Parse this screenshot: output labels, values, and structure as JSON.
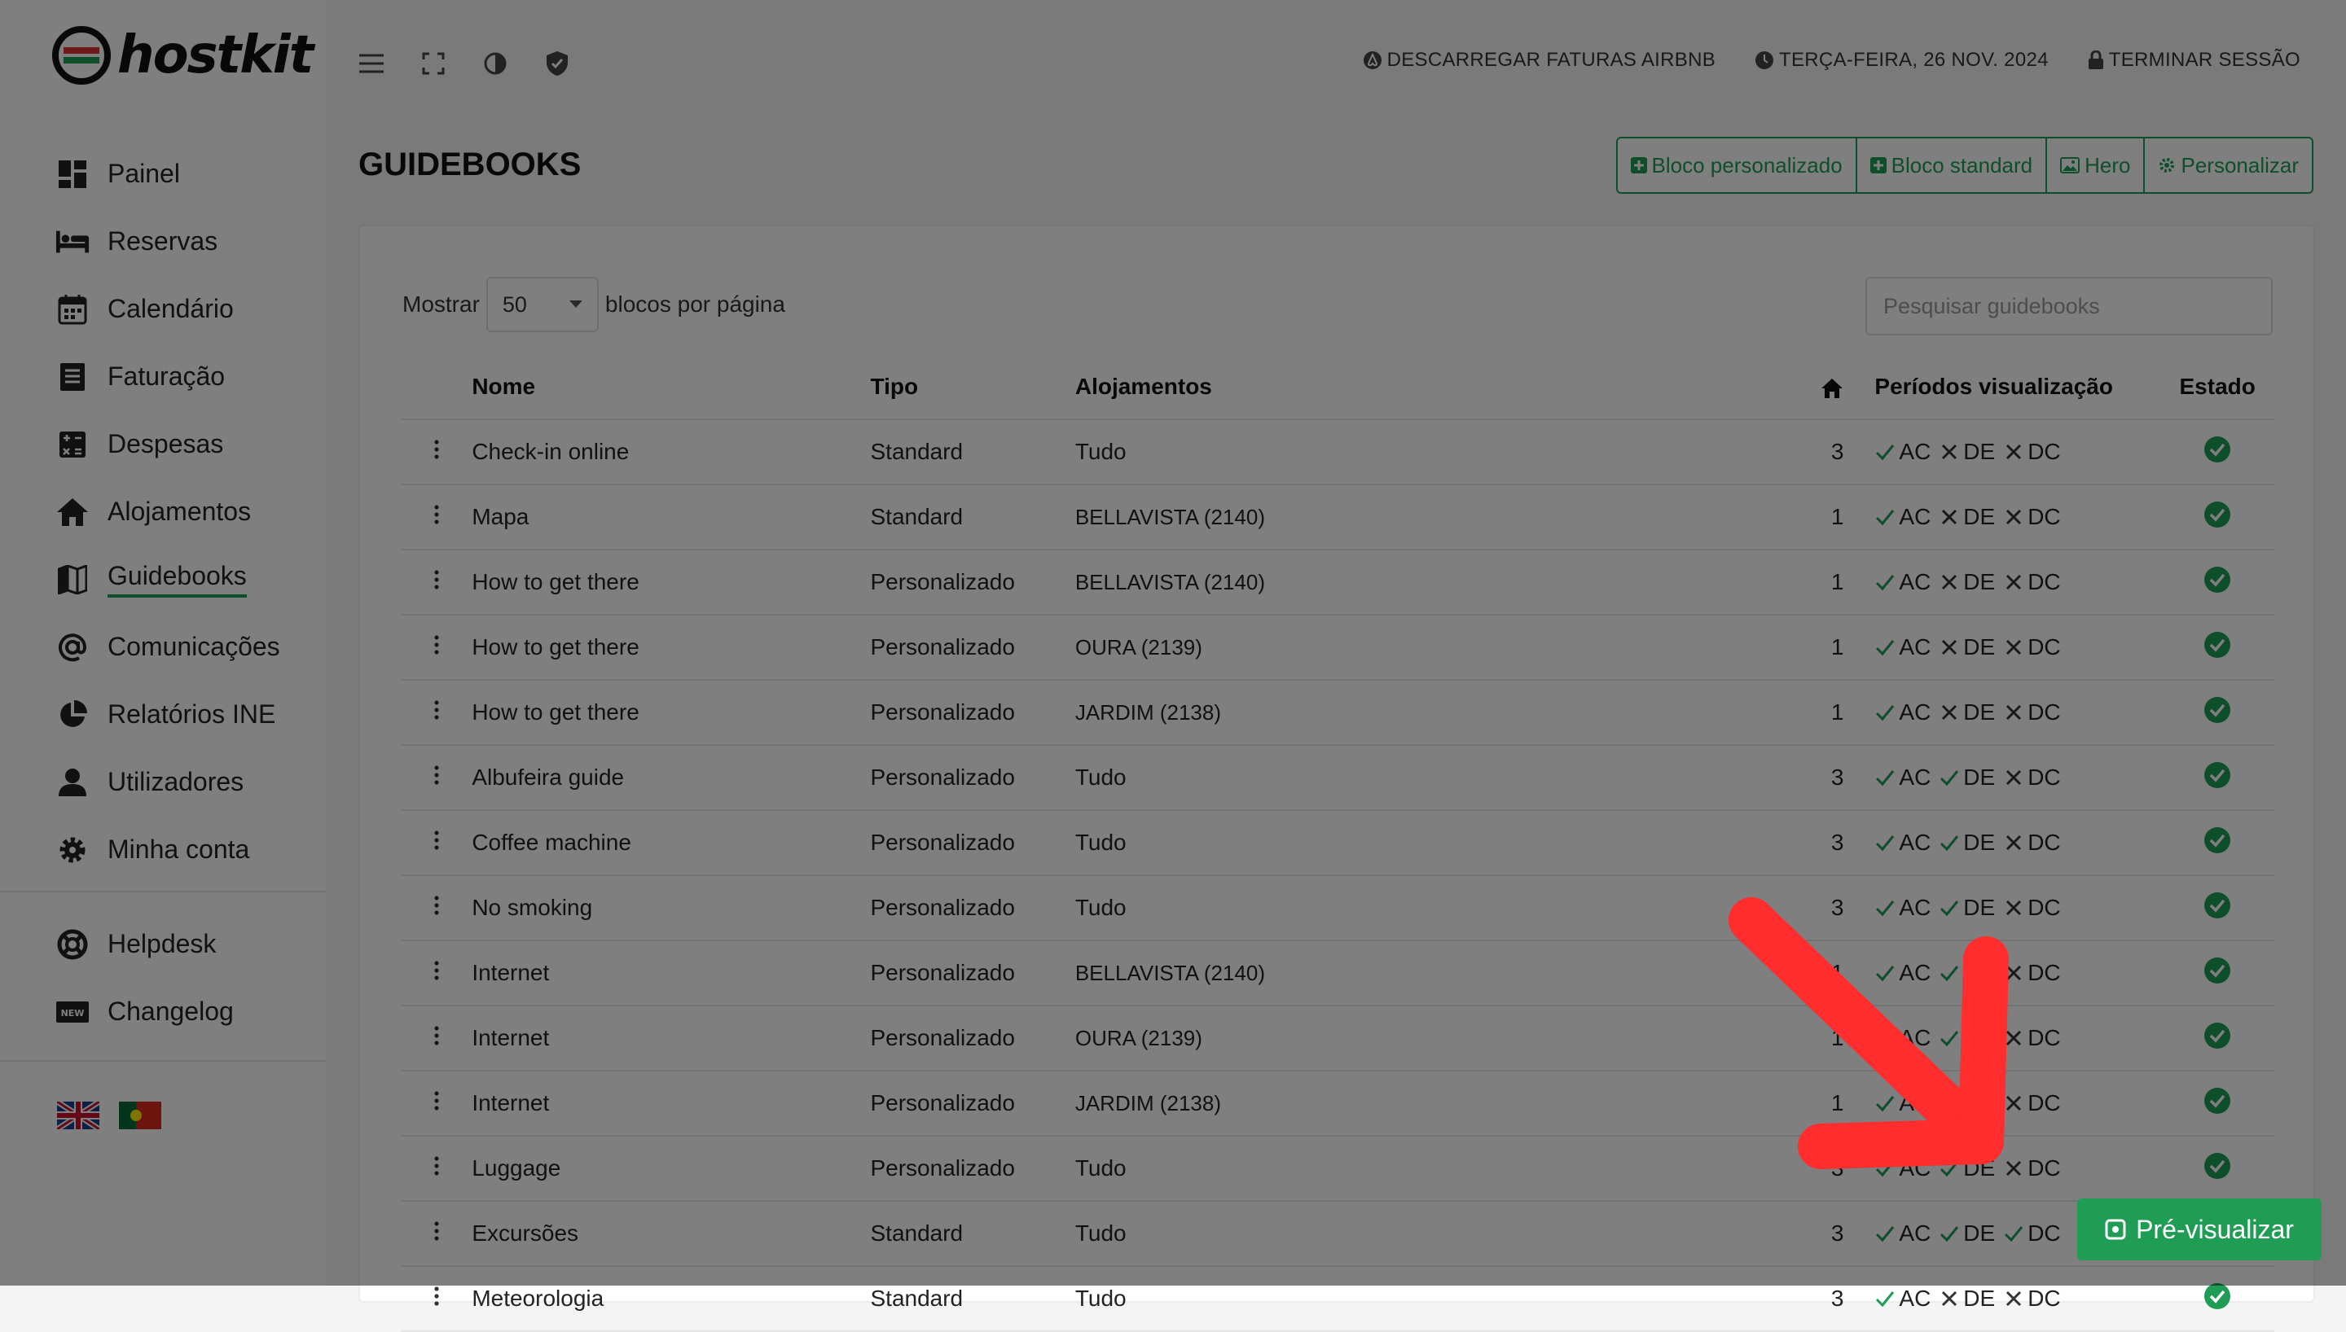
{
  "app": {
    "logo_text": "hostkit"
  },
  "sidebar": {
    "items": [
      {
        "label": "Painel",
        "icon": "dashboard-icon"
      },
      {
        "label": "Reservas",
        "icon": "bed-icon"
      },
      {
        "label": "Calendário",
        "icon": "calendar-icon"
      },
      {
        "label": "Faturação",
        "icon": "invoice-icon"
      },
      {
        "label": "Despesas",
        "icon": "calculator-icon"
      },
      {
        "label": "Alojamentos",
        "icon": "home-icon"
      },
      {
        "label": "Guidebooks",
        "icon": "map-icon",
        "active": true
      },
      {
        "label": "Comunicações",
        "icon": "at-icon"
      },
      {
        "label": "Relatórios INE",
        "icon": "pie-chart-icon"
      },
      {
        "label": "Utilizadores",
        "icon": "user-icon"
      },
      {
        "label": "Minha conta",
        "icon": "gear-icon"
      }
    ],
    "secondary": [
      {
        "label": "Helpdesk",
        "icon": "lifebuoy-icon"
      },
      {
        "label": "Changelog",
        "icon": "new-badge-icon"
      }
    ]
  },
  "topbar": {
    "download_airbnb": "DESCARREGAR FATURAS AIRBNB",
    "date": "TERÇA-FEIRA, 26 NOV. 2024",
    "logout": "TERMINAR SESSÃO"
  },
  "page": {
    "title": "GUIDEBOOKS",
    "buttons": {
      "custom_block": "Bloco personalizado",
      "standard_block": "Bloco standard",
      "hero": "Hero",
      "customize": "Personalizar"
    }
  },
  "list": {
    "show_label": "Mostrar",
    "per_page": "50",
    "per_page_suffix": "blocos por página",
    "search_placeholder": "Pesquisar guidebooks",
    "columns": {
      "name": "Nome",
      "type": "Tipo",
      "properties": "Alojamentos",
      "periods": "Períodos visualização",
      "status": "Estado"
    },
    "period_labels": [
      "AC",
      "DE",
      "DC"
    ],
    "rows": [
      {
        "name": "Check-in online",
        "type": "Standard",
        "properties": "Tudo",
        "count": "3",
        "ac": true,
        "de": false,
        "dc": false
      },
      {
        "name": "Mapa",
        "type": "Standard",
        "properties": "BELLAVISTA (2140)",
        "count": "1",
        "ac": true,
        "de": false,
        "dc": false
      },
      {
        "name": "How to get there",
        "type": "Personalizado",
        "properties": "BELLAVISTA (2140)",
        "count": "1",
        "ac": true,
        "de": false,
        "dc": false
      },
      {
        "name": "How to get there",
        "type": "Personalizado",
        "properties": "OURA (2139)",
        "count": "1",
        "ac": true,
        "de": false,
        "dc": false
      },
      {
        "name": "How to get there",
        "type": "Personalizado",
        "properties": "JARDIM (2138)",
        "count": "1",
        "ac": true,
        "de": false,
        "dc": false
      },
      {
        "name": "Albufeira guide",
        "type": "Personalizado",
        "properties": "Tudo",
        "count": "3",
        "ac": true,
        "de": true,
        "dc": false
      },
      {
        "name": "Coffee machine",
        "type": "Personalizado",
        "properties": "Tudo",
        "count": "3",
        "ac": true,
        "de": true,
        "dc": false
      },
      {
        "name": "No smoking",
        "type": "Personalizado",
        "properties": "Tudo",
        "count": "3",
        "ac": true,
        "de": true,
        "dc": false
      },
      {
        "name": "Internet",
        "type": "Personalizado",
        "properties": "BELLAVISTA (2140)",
        "count": "1",
        "ac": true,
        "de": true,
        "dc": false
      },
      {
        "name": "Internet",
        "type": "Personalizado",
        "properties": "OURA (2139)",
        "count": "1",
        "ac": true,
        "de": true,
        "dc": false
      },
      {
        "name": "Internet",
        "type": "Personalizado",
        "properties": "JARDIM (2138)",
        "count": "1",
        "ac": true,
        "de": true,
        "dc": false
      },
      {
        "name": "Luggage",
        "type": "Personalizado",
        "properties": "Tudo",
        "count": "3",
        "ac": true,
        "de": true,
        "dc": false
      },
      {
        "name": "Excursões",
        "type": "Standard",
        "properties": "Tudo",
        "count": "3",
        "ac": true,
        "de": true,
        "dc": true
      },
      {
        "name": "Meteorologia",
        "type": "Standard",
        "properties": "Tudo",
        "count": "3",
        "ac": true,
        "de": false,
        "dc": false
      }
    ]
  },
  "preview_button": "Pré-visualizar",
  "colors": {
    "accent": "#1f9d55",
    "arrow": "#ff2d2d"
  }
}
